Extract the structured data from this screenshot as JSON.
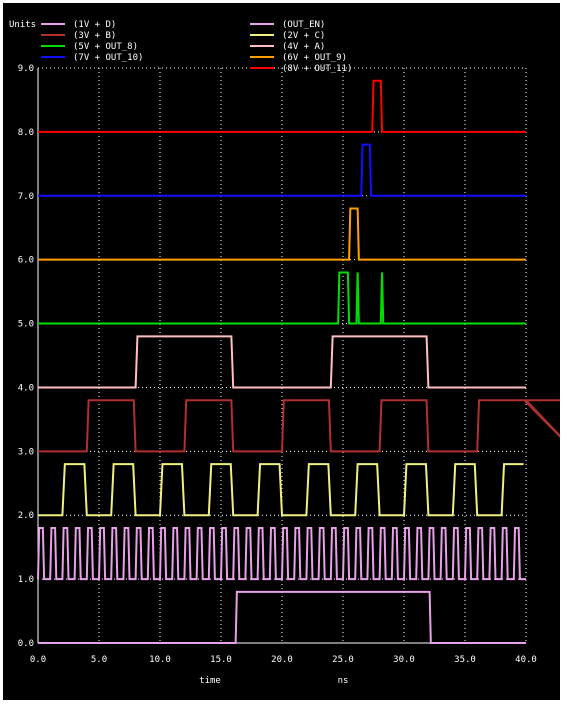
{
  "chart_data": {
    "type": "line",
    "ylabel": "Units",
    "xlabel": "time",
    "xunit": "ns",
    "xlim": [
      0,
      40
    ],
    "ylim": [
      0,
      9
    ],
    "xticks": [
      "0.0",
      "5.0",
      "10.0",
      "15.0",
      "20.0",
      "25.0",
      "30.0",
      "35.0",
      "40.0"
    ],
    "yticks": [
      "0.0",
      "1.0",
      "2.0",
      "3.0",
      "4.0",
      "5.0",
      "6.0",
      "7.0",
      "8.0",
      "9.0"
    ],
    "grid": true,
    "legend_position": "top",
    "series": [
      {
        "name": "(1V + D)",
        "color": "#e8a0e8",
        "kind": "clock",
        "offset": 1,
        "high": 0.8,
        "first": 0,
        "half": 0.5,
        "lead": 0,
        "count": 40,
        "rise": 0.1
      },
      {
        "name": "(3V + B)",
        "color": "#b03030",
        "kind": "clock",
        "offset": 3,
        "high": 0.8,
        "first": 4,
        "half": 4,
        "lead": 0,
        "count": 6,
        "rise": 0.15
      },
      {
        "name": "(5V + OUT_8)",
        "color": "#00e000",
        "kind": "pulses",
        "offset": 5,
        "high": 0.8,
        "pulses": [
          [
            24.6,
            25.5
          ],
          [
            26.1,
            26.3
          ],
          [
            28.1,
            28.3
          ]
        ]
      },
      {
        "name": "(7V + OUT_10)",
        "color": "#1010ff",
        "kind": "pulses",
        "offset": 7,
        "high": 0.8,
        "pulses": [
          [
            26.5,
            27.3
          ]
        ]
      },
      {
        "name": "(OUT_EN)",
        "color": "#e8a0e8",
        "kind": "pulses",
        "offset": 0,
        "high": 0.8,
        "pulses": [
          [
            16.2,
            32.2
          ]
        ]
      },
      {
        "name": "(2V + C)",
        "color": "#f0f080",
        "kind": "clock",
        "offset": 2,
        "high": 0.8,
        "first": 2,
        "half": 2,
        "lead": 0,
        "count": 10,
        "rise": 0.2
      },
      {
        "name": "(4V + A)",
        "color": "#ffc0c0",
        "kind": "clock",
        "offset": 4,
        "high": 0.8,
        "first": 8,
        "half": 8,
        "lead": 0,
        "count": 2,
        "rise": 0.15
      },
      {
        "name": "(6V + OUT_9)",
        "color": "#ffa000",
        "kind": "pulses",
        "offset": 6,
        "high": 0.8,
        "pulses": [
          [
            25.5,
            26.3
          ]
        ]
      },
      {
        "name": "(8V + OUT_11)",
        "color": "#ff0000",
        "kind": "pulses",
        "offset": 8,
        "high": 0.8,
        "pulses": [
          [
            27.4,
            28.2
          ]
        ]
      }
    ]
  }
}
